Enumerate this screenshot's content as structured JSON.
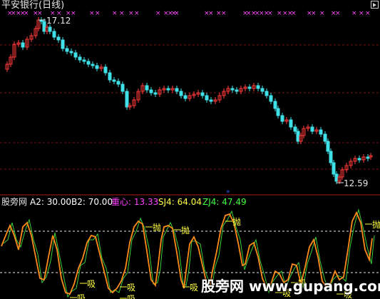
{
  "window": {
    "title": "平安银行(日线)"
  },
  "top_pane": {
    "high_label": "17.12",
    "low_label": "12.59",
    "colors": {
      "up": "#ff3a3a",
      "down": "#40e0e8",
      "marker": "#ff4dff",
      "grid": "#7a1010"
    }
  },
  "bottom_pane": {
    "indicator_name": "股旁网",
    "params": {
      "a2": "A2: 30.00",
      "b2": "B2: 70.00",
      "center": "重心: 13.33",
      "sj4": "SJ4: 64.04",
      "zj4": "ZJ4: 47.49"
    },
    "colors": {
      "a2": "#ffffff",
      "b2": "#ffffff",
      "center": "#ff40ff",
      "sj4": "#ffff40",
      "zj4": "#40ff40",
      "line_orange": "#ff8c1a",
      "line_green": "#3cd03c"
    },
    "sell_label": "抛",
    "buy_label": "吸"
  },
  "watermark": "股旁网 www.gupang.com",
  "icons": {
    "expand": "expand-arrow-icon",
    "scroll_marker": "scroll-marker-icon"
  }
}
